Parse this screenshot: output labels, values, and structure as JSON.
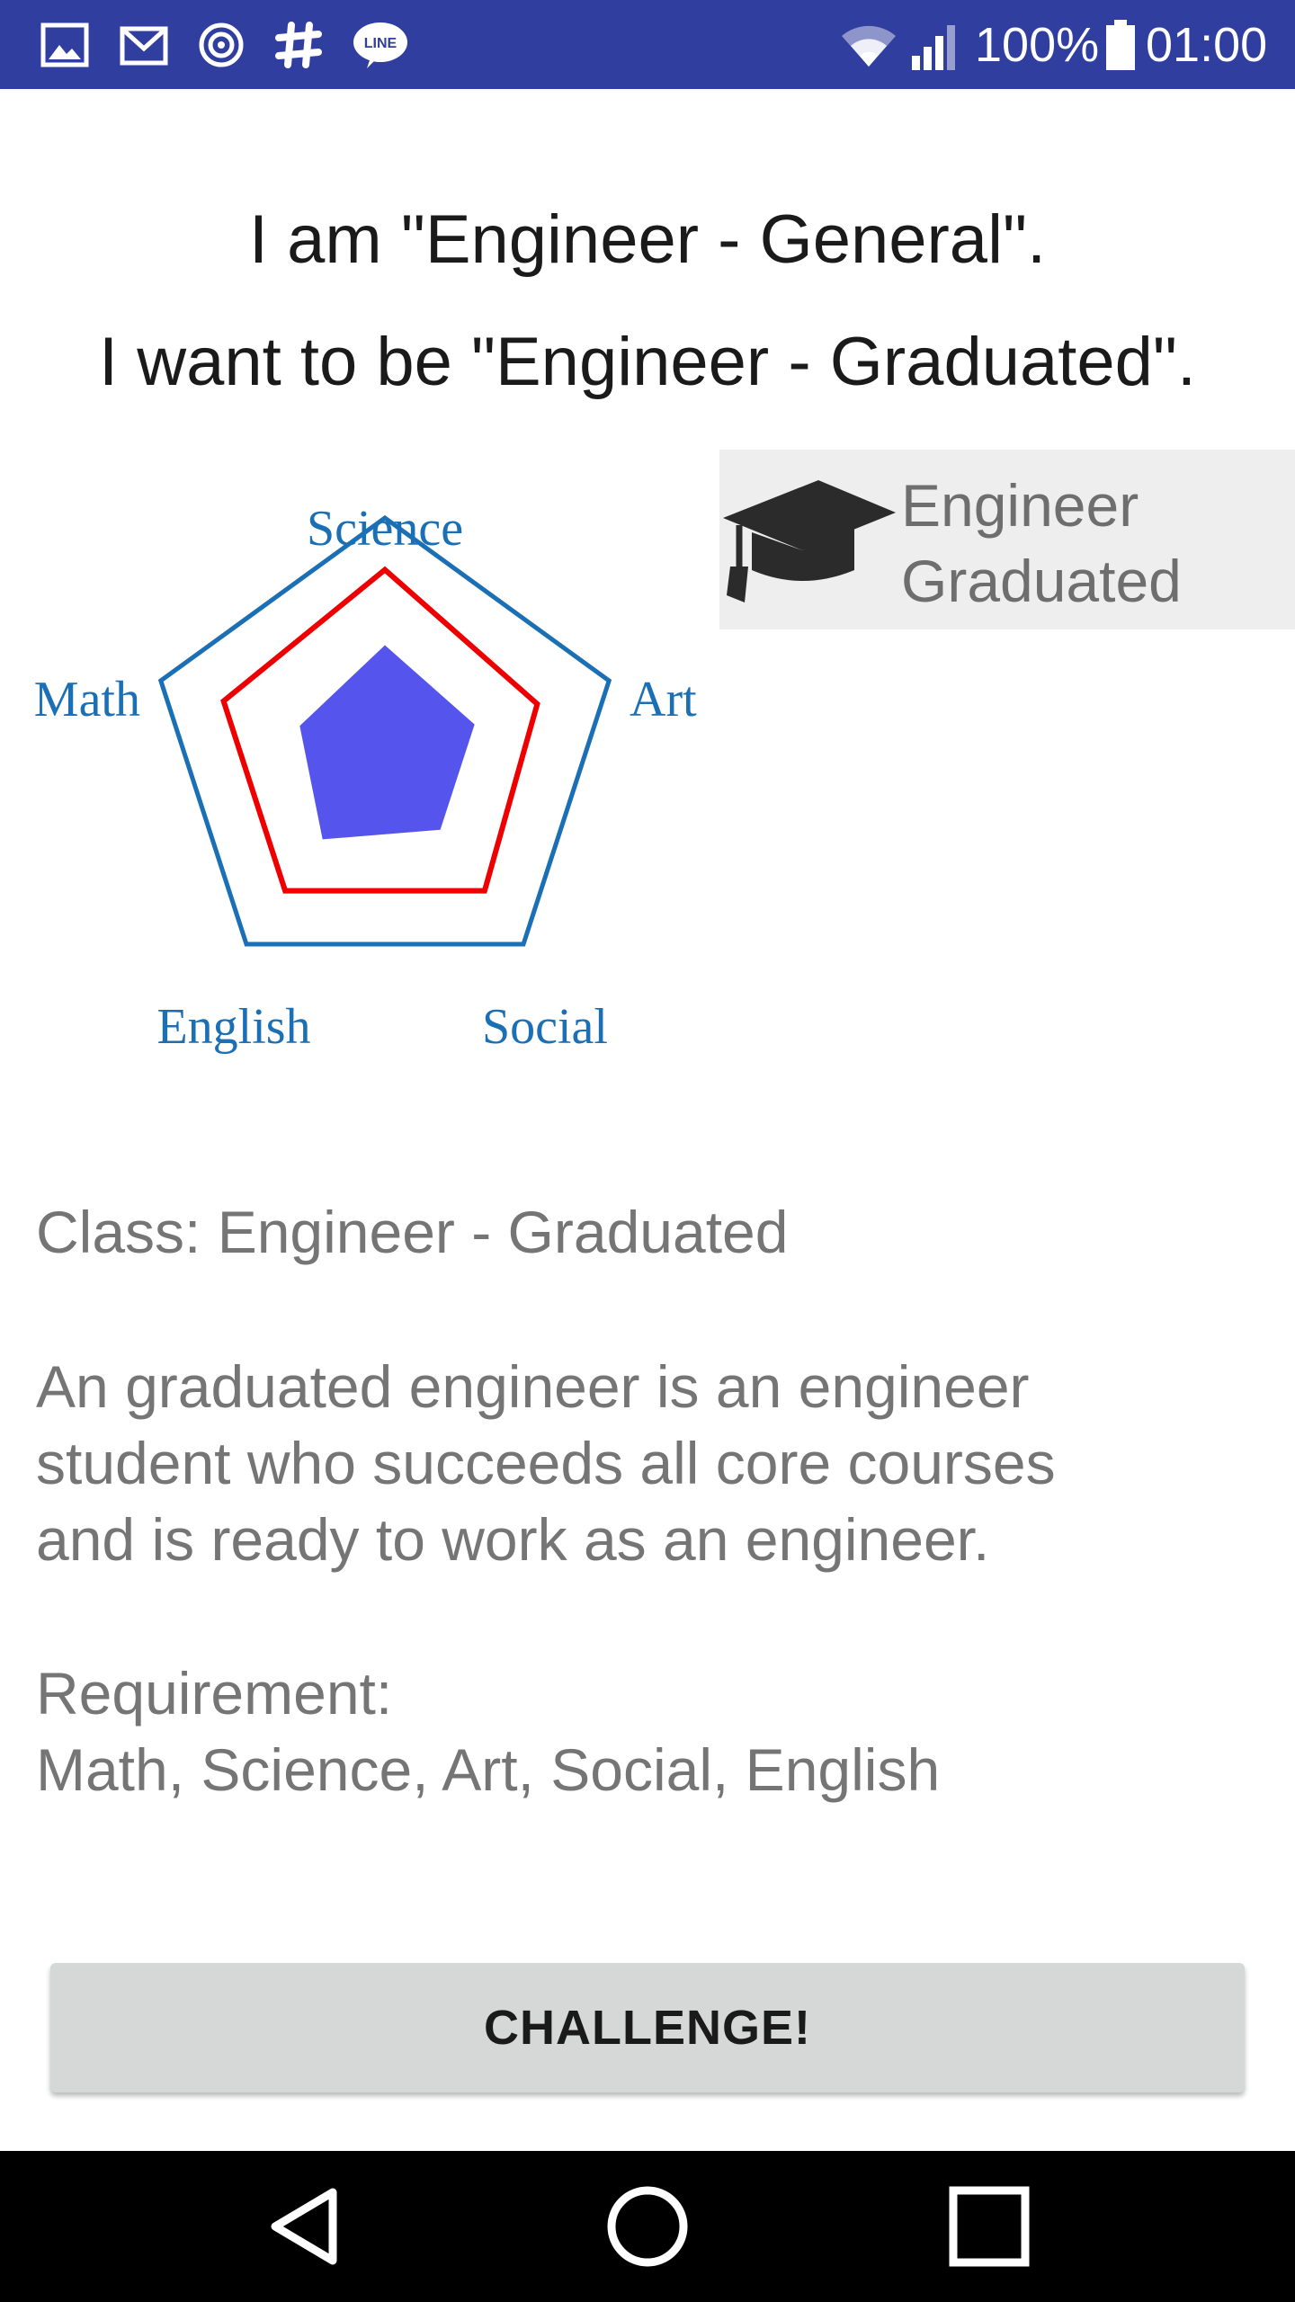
{
  "status_bar": {
    "left_icons": [
      "image-icon",
      "gmail-icon",
      "at-icon",
      "slack-icon",
      "line-icon"
    ],
    "line_label": "LINE",
    "battery_text": "100%",
    "clock": "01:00",
    "bg_color": "#303f9f"
  },
  "header": {
    "line1": "I am \"Engineer - General\".",
    "line2": "I want to be \"Engineer - Graduated\"."
  },
  "chart_data": {
    "type": "radar",
    "axes": [
      "Science",
      "Art",
      "Social",
      "English",
      "Math"
    ],
    "max": 100,
    "series": [
      {
        "role": "scale",
        "values": [
          100,
          100,
          100,
          100,
          100
        ],
        "color": "#1a6fb5"
      },
      {
        "role": "required",
        "values": [
          78,
          68,
          72,
          72,
          72
        ],
        "color": "#ee0000"
      },
      {
        "role": "current",
        "values": [
          46,
          40,
          40,
          45,
          38
        ],
        "color": "#5555ee"
      }
    ]
  },
  "badge": {
    "icon": "graduation-cap-icon",
    "line1": "Engineer",
    "line2": "Graduated"
  },
  "description": {
    "class_line": "Class: Engineer - Graduated",
    "summary_lines": [
      "An graduated engineer is an engineer",
      "student who succeeds all core courses",
      "and is ready to work as an engineer."
    ],
    "requirement_title": "Requirement:",
    "requirement_list": "Math, Science, Art, Social, English"
  },
  "actions": {
    "challenge_label": "CHALLENGE!"
  },
  "nav_bar": {
    "buttons": [
      "back-icon",
      "home-icon",
      "recents-icon"
    ]
  }
}
